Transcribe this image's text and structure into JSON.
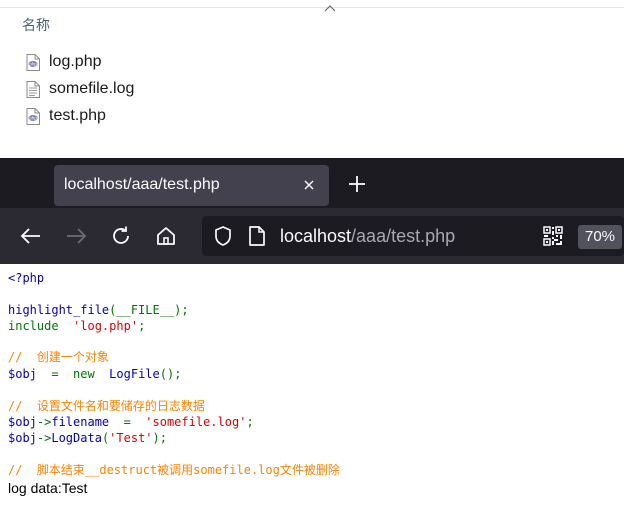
{
  "explorer": {
    "column_header": "名称",
    "files": [
      {
        "name": "log.php",
        "icon": "php-file-icon"
      },
      {
        "name": "somefile.log",
        "icon": "text-file-icon"
      },
      {
        "name": "test.php",
        "icon": "php-file-icon"
      }
    ]
  },
  "browser": {
    "tab_title": "localhost/aaa/test.php",
    "url_host": "localhost",
    "url_path": "/aaa/test.php",
    "zoom": "70%"
  },
  "code": {
    "line1": "<?php",
    "line2_fn": "highlight_file",
    "line2_rest": "(__FILE__);",
    "line3_kw": "include",
    "line3_str": "'log.php'",
    "line4_cmt": "//  创建一个对象",
    "line5_var": "$obj",
    "line5_eq": "  =  ",
    "line5_new": "new",
    "line5_cls": "LogFile",
    "line6_cmt": "//  设置文件名和要储存的日志数据",
    "line7_var": "$obj",
    "line7_prop": "filename",
    "line7_str": "'somefile.log'",
    "line8_var": "$obj",
    "line8_fn": "LogData",
    "line8_str": "'Test'",
    "line9_cmt": "//  脚本结束__destruct被调用somefile.log文件被删除"
  },
  "output": "log data:Test",
  "colors": {
    "php_keyword": "#007700",
    "php_default": "#0000bb",
    "php_string": "#dd0000",
    "php_comment": "#ff8000",
    "tab_strip": "#1c1b22",
    "toolbar": "#2b2a33"
  }
}
